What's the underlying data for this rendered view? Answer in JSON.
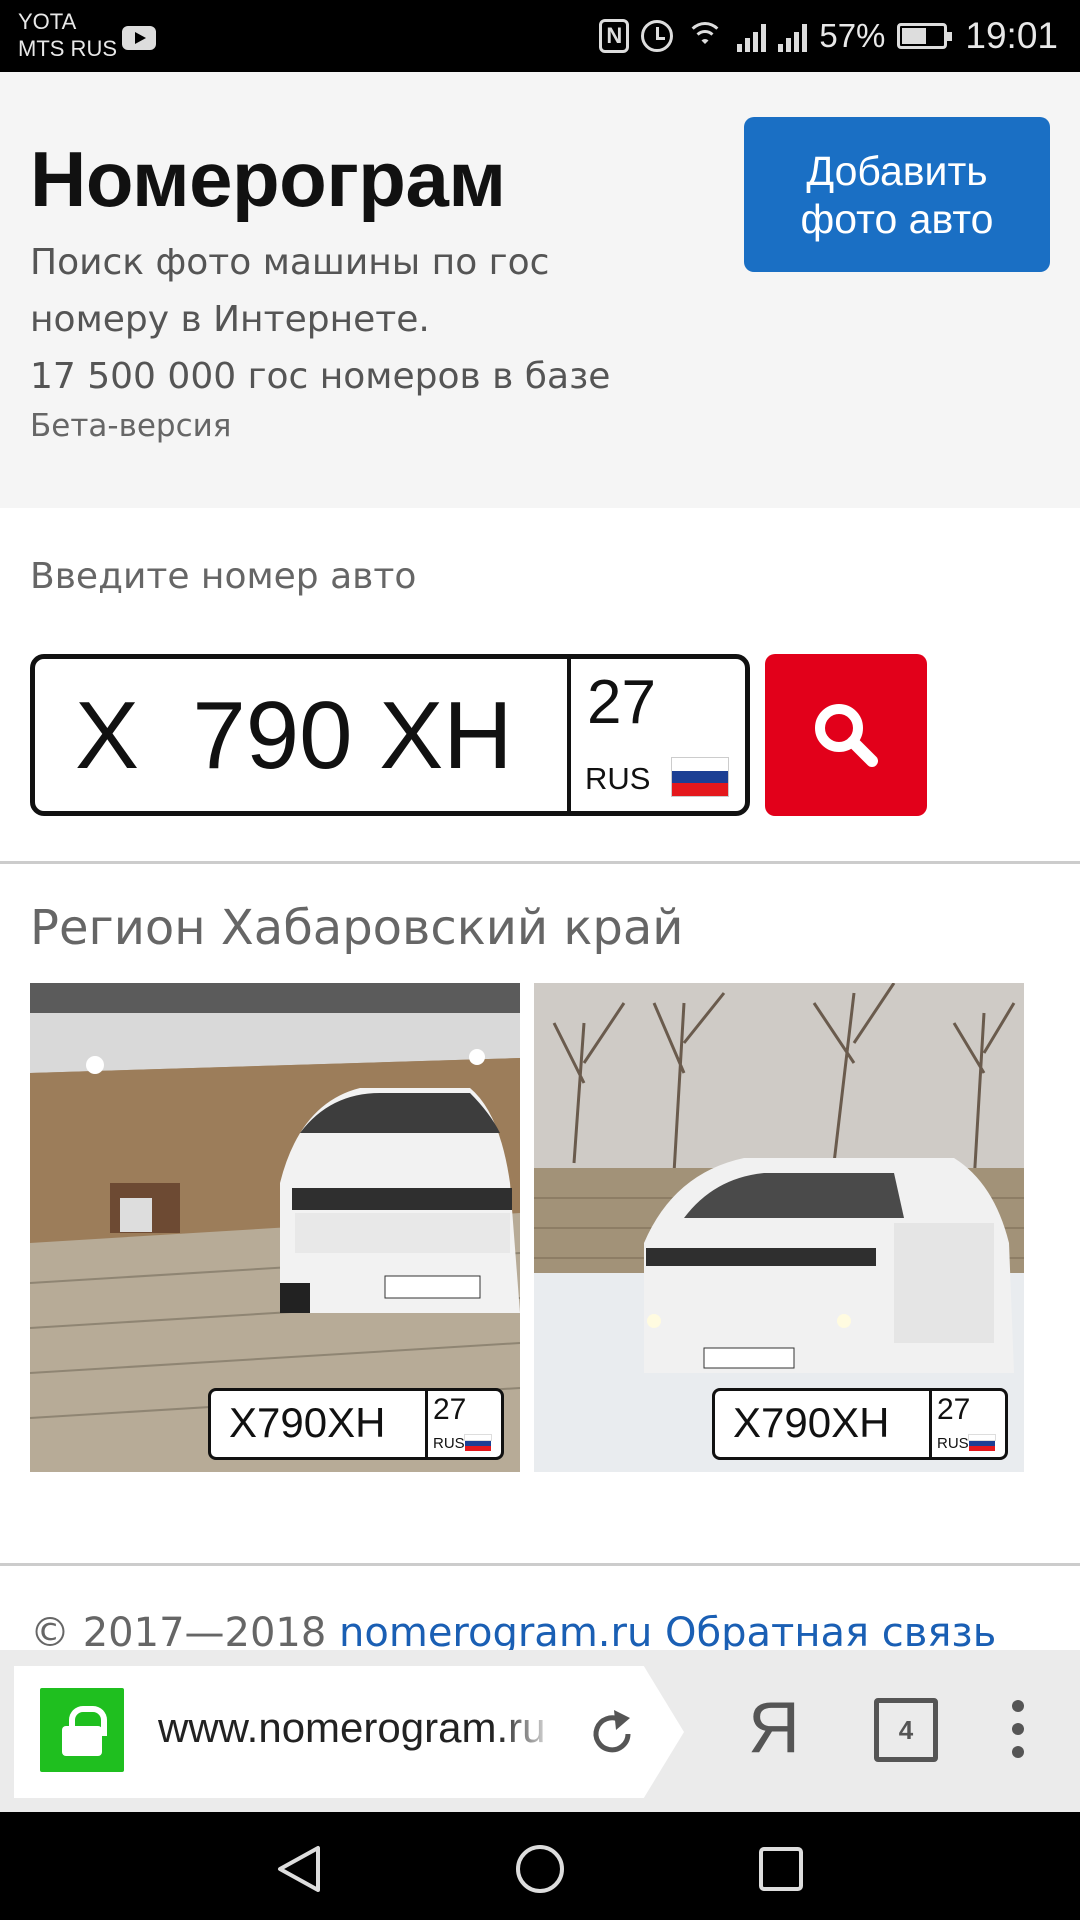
{
  "status_bar": {
    "carrier_1": "YOTA",
    "carrier_2": "MTS RUS",
    "nfc_label": "N",
    "battery": "57%",
    "time": "19:01"
  },
  "header": {
    "title": "Номерограм",
    "description_line1": "Поиск фото машины по гос",
    "description_line2": "номеру в Интернете.",
    "description_line3": "17 500 000 гос номеров в базе",
    "beta": "Бета-версия",
    "add_button_line1": "Добавить",
    "add_button_line2": "фото авто"
  },
  "search": {
    "label": "Введите номер авто",
    "plate_number": "X  790 XH",
    "plate_region": "27",
    "plate_country": "RUS"
  },
  "results": {
    "region_title": "Регион Хабаровский край",
    "photos": [
      {
        "plate": "X790XH",
        "region": "27",
        "country": "RUS",
        "scene": "garage"
      },
      {
        "plate": "X790XH",
        "region": "27",
        "country": "RUS",
        "scene": "winter-street"
      }
    ]
  },
  "footer": {
    "copyright": "© 2017—2018",
    "site_link": "nomerogram.ru",
    "feedback_link": "Обратная связь"
  },
  "browser": {
    "url": "www.nomerogram.ru",
    "yandex_label": "Я",
    "tab_count": "4"
  },
  "colors": {
    "accent_blue": "#1a6fc4",
    "search_red": "#e2001a",
    "lock_green": "#1fbf1f",
    "flag_white": "#ffffff",
    "flag_blue": "#1c3f94",
    "flag_red": "#e4181c"
  },
  "icons": {
    "search_button": "magnifier-icon",
    "lock": "lock-icon",
    "reload": "reload-icon",
    "back": "back-triangle-icon",
    "home": "home-circle-icon",
    "recents": "recents-square-icon"
  }
}
